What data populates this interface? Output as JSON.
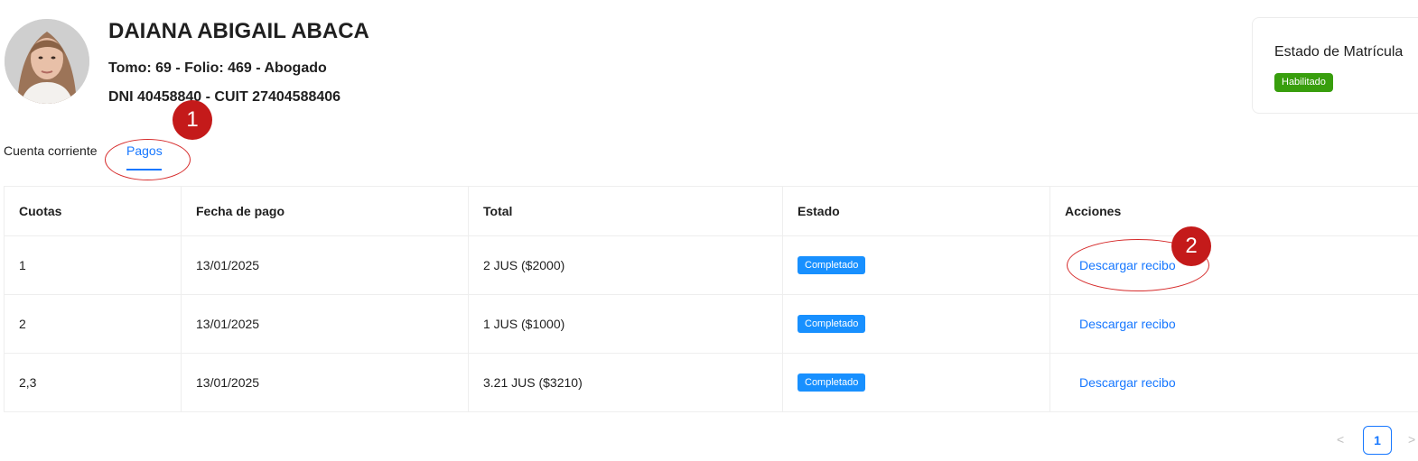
{
  "profile": {
    "name": "DAIANA ABIGAIL ABACA",
    "line1": "Tomo: 69 - Folio: 469 - Abogado",
    "line2": "DNI 40458840 - CUIT 27404588406"
  },
  "status_card": {
    "title": "Estado de Matrícula",
    "tag": "Habilitado",
    "tag_color": "#389e0d"
  },
  "tabs": [
    {
      "label": "Cuenta corriente",
      "active": false
    },
    {
      "label": "Pagos",
      "active": true
    }
  ],
  "table": {
    "headers": [
      "Cuotas",
      "Fecha de pago",
      "Total",
      "Estado",
      "Acciones"
    ],
    "rows": [
      {
        "cuotas": "1",
        "fecha": "13/01/2025",
        "total": "2 JUS ($2000)",
        "estado": "Completado",
        "accion": "Descargar recibo"
      },
      {
        "cuotas": "2",
        "fecha": "13/01/2025",
        "total": "1 JUS ($1000)",
        "estado": "Completado",
        "accion": "Descargar recibo"
      },
      {
        "cuotas": "2,3",
        "fecha": "13/01/2025",
        "total": "3.21 JUS ($3210)",
        "estado": "Completado",
        "accion": "Descargar recibo"
      }
    ]
  },
  "pagination": {
    "prev": "<",
    "current": "1",
    "next": ">"
  },
  "annotations": {
    "marker1": "1",
    "marker2": "2",
    "color": "#c41a1a"
  },
  "colors": {
    "accent": "#1677ff",
    "tag_done": "#1890ff"
  }
}
